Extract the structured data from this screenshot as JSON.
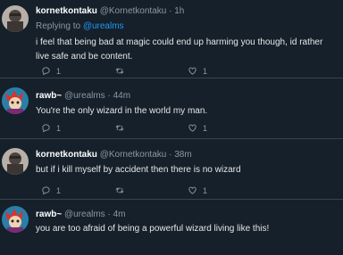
{
  "tweets": [
    {
      "name": "kornetkontaku",
      "handle": "@Kornetkontaku",
      "sep": "·",
      "time": "1h",
      "replying_prefix": "Replying to ",
      "replying_to": "@urealms",
      "text": "i feel that being bad at magic could end up harming you though, id rather live safe and be content.",
      "reply_count": "1",
      "retweet_count": "",
      "like_count": "1"
    },
    {
      "name": "rawb~",
      "handle": "@urealms",
      "sep": "·",
      "time": "44m",
      "text": "You're the only wizard in the world my man.",
      "reply_count": "1",
      "retweet_count": "",
      "like_count": "1"
    },
    {
      "name": "kornetkontaku",
      "handle": "@Kornetkontaku",
      "sep": "·",
      "time": "38m",
      "text": "but if i kill myself by accident then there is no wizard",
      "reply_count": "1",
      "retweet_count": "",
      "like_count": "1"
    },
    {
      "name": "rawb~",
      "handle": "@urealms",
      "sep": "·",
      "time": "4m",
      "text": "you are too afraid of being a powerful wizard living like this!",
      "reply_count": "",
      "retweet_count": "",
      "like_count": ""
    }
  ],
  "icons": {
    "reply": "reply-icon",
    "retweet": "retweet-icon",
    "like": "heart-icon"
  }
}
